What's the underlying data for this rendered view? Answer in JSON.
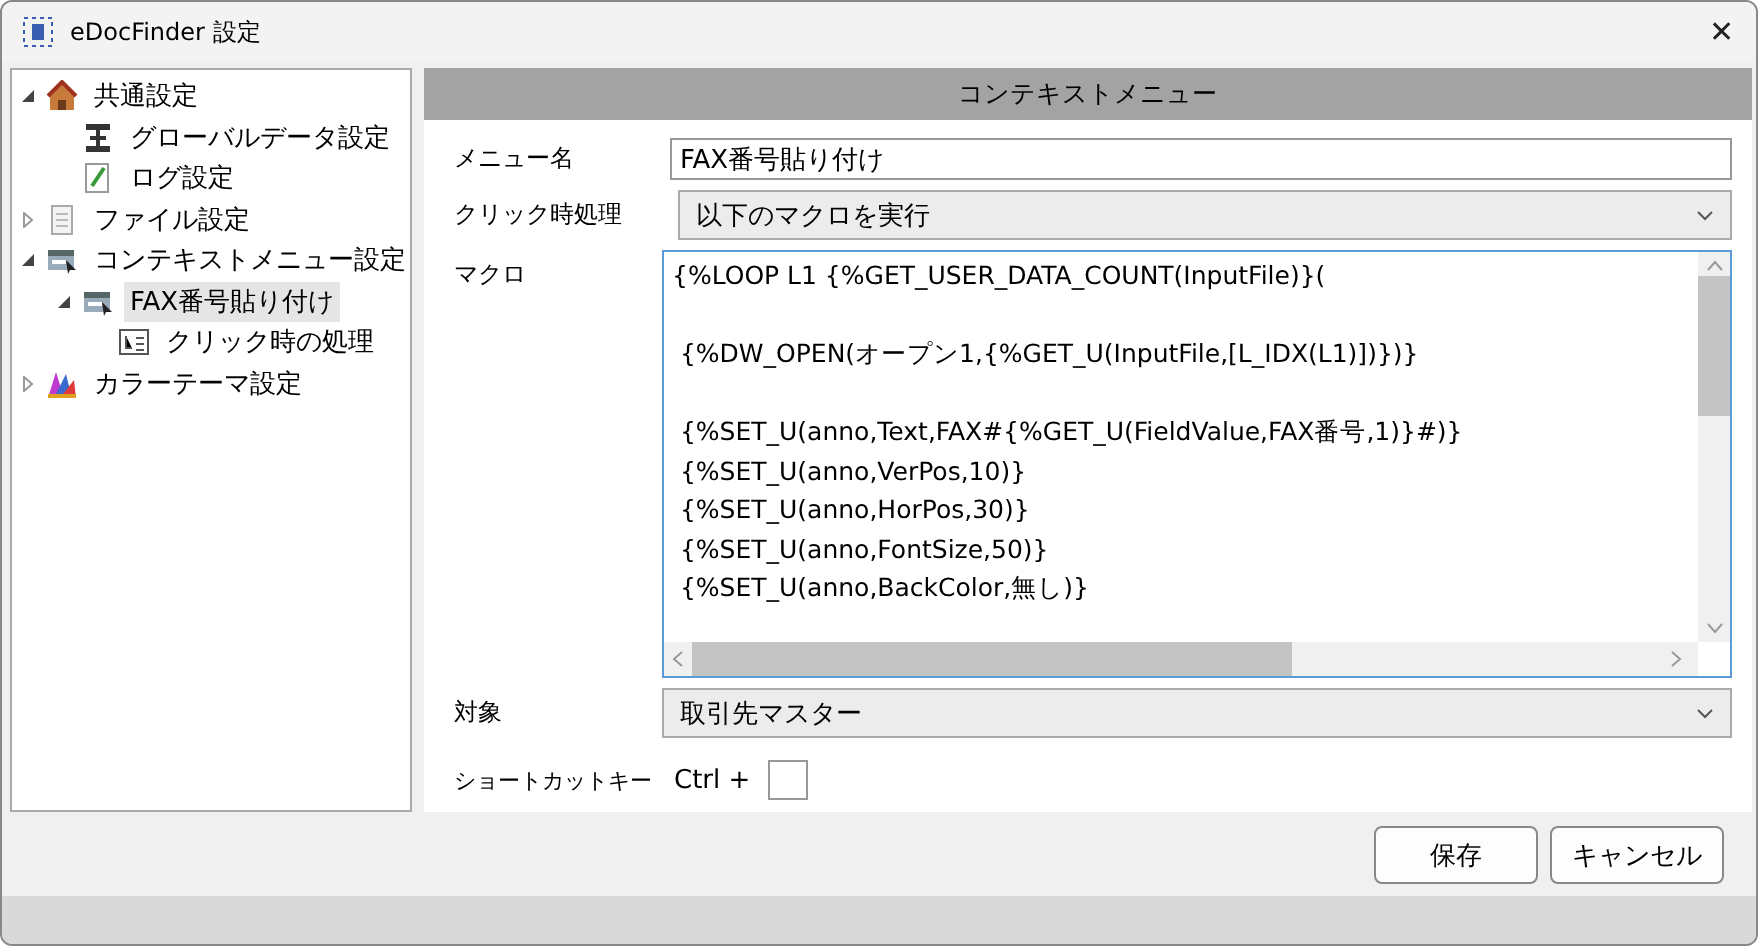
{
  "window": {
    "title": "eDocFinder 設定",
    "close": "✕"
  },
  "tree": [
    {
      "label": "共通設定",
      "expanded": true,
      "selected": false,
      "children": [
        {
          "label": "グローバルデータ設定",
          "selected": false
        },
        {
          "label": "ログ設定",
          "selected": false
        }
      ]
    },
    {
      "label": "ファイル設定",
      "expanded": false,
      "selected": false
    },
    {
      "label": "コンテキストメニュー設定",
      "expanded": true,
      "selected": false,
      "children": [
        {
          "label": "FAX番号貼り付け",
          "expanded": true,
          "selected": true,
          "children": [
            {
              "label": "クリック時の処理",
              "selected": false
            }
          ]
        }
      ]
    },
    {
      "label": "カラーテーマ設定",
      "expanded": false,
      "selected": false
    }
  ],
  "panel": {
    "header": "コンテキストメニュー",
    "menu_name": {
      "label": "メニュー名",
      "value": "FAX番号貼り付け"
    },
    "click_action": {
      "label": "クリック時処理",
      "value": "以下のマクロを実行"
    },
    "macro": {
      "label": "マクロ",
      "value": "{%LOOP L1 {%GET_USER_DATA_COUNT(InputFile)}(\n\n {%DW_OPEN(オープン1,{%GET_U(InputFile,[L_IDX(L1)])})}\n\n {%SET_U(anno,Text,FAX#{%GET_U(FieldValue,FAX番号,1)}#)}\n {%SET_U(anno,VerPos,10)}\n {%SET_U(anno,HorPos,30)}\n {%SET_U(anno,FontSize,50)}\n {%SET_U(anno,BackColor,無し)}"
    },
    "target": {
      "label": "対象",
      "value": "取引先マスター"
    },
    "shortcut": {
      "label": "ショートカットキー",
      "prefix": "Ctrl +"
    }
  },
  "buttons": [
    "保存",
    "キャンセル"
  ]
}
